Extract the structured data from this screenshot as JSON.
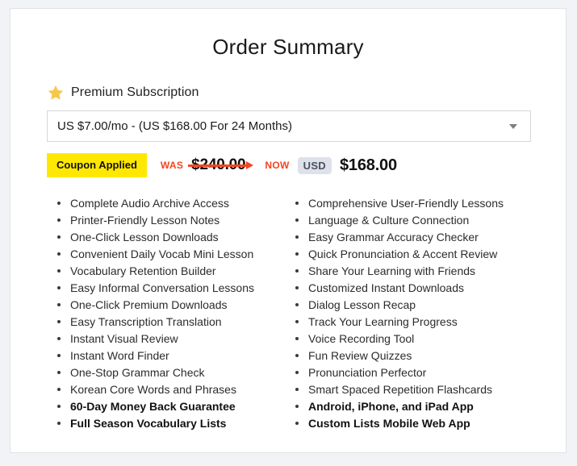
{
  "page": {
    "title": "Order Summary",
    "card_background": "#ffffff",
    "page_background": "#f2f3f7"
  },
  "plan": {
    "icon": "star-icon",
    "star_color": "#f5c84c",
    "label": "Premium Subscription",
    "select": {
      "value": "US $7.00/mo - (US $168.00 For 24 Months)",
      "caret_icon": "chevron-down-icon"
    }
  },
  "pricing": {
    "coupon_label": "Coupon Applied",
    "coupon_background": "#ffe800",
    "was_label": "WAS",
    "old_price": "$240.00",
    "now_label": "NOW",
    "currency": "USD",
    "new_price": "$168.00",
    "accent_color": "#f5451f",
    "currency_badge_background": "#dde1ea"
  },
  "features": {
    "left": [
      {
        "label": "Complete Audio Archive Access",
        "bold": false
      },
      {
        "label": "Printer-Friendly Lesson Notes",
        "bold": false
      },
      {
        "label": "One-Click Lesson Downloads",
        "bold": false
      },
      {
        "label": "Convenient Daily Vocab Mini Lesson",
        "bold": false
      },
      {
        "label": "Vocabulary Retention Builder",
        "bold": false
      },
      {
        "label": "Easy Informal Conversation Lessons",
        "bold": false
      },
      {
        "label": "One-Click Premium Downloads",
        "bold": false
      },
      {
        "label": "Easy Transcription Translation",
        "bold": false
      },
      {
        "label": "Instant Visual Review",
        "bold": false
      },
      {
        "label": "Instant Word Finder",
        "bold": false
      },
      {
        "label": "One-Stop Grammar Check",
        "bold": false
      },
      {
        "label": "Korean Core Words and Phrases",
        "bold": false
      },
      {
        "label": "60-Day Money Back Guarantee",
        "bold": true
      },
      {
        "label": "Full Season Vocabulary Lists",
        "bold": true
      }
    ],
    "right": [
      {
        "label": "Comprehensive User-Friendly Lessons",
        "bold": false
      },
      {
        "label": "Language & Culture Connection",
        "bold": false
      },
      {
        "label": "Easy Grammar Accuracy Checker",
        "bold": false
      },
      {
        "label": "Quick Pronunciation & Accent Review",
        "bold": false
      },
      {
        "label": "Share Your Learning with Friends",
        "bold": false
      },
      {
        "label": "Customized Instant Downloads",
        "bold": false
      },
      {
        "label": "Dialog Lesson Recap",
        "bold": false
      },
      {
        "label": "Track Your Learning Progress",
        "bold": false
      },
      {
        "label": "Voice Recording Tool",
        "bold": false
      },
      {
        "label": "Fun Review Quizzes",
        "bold": false
      },
      {
        "label": "Pronunciation Perfector",
        "bold": false
      },
      {
        "label": "Smart Spaced Repetition Flashcards",
        "bold": false
      },
      {
        "label": "Android, iPhone, and iPad App",
        "bold": true
      },
      {
        "label": "Custom Lists Mobile Web App",
        "bold": true
      }
    ]
  }
}
